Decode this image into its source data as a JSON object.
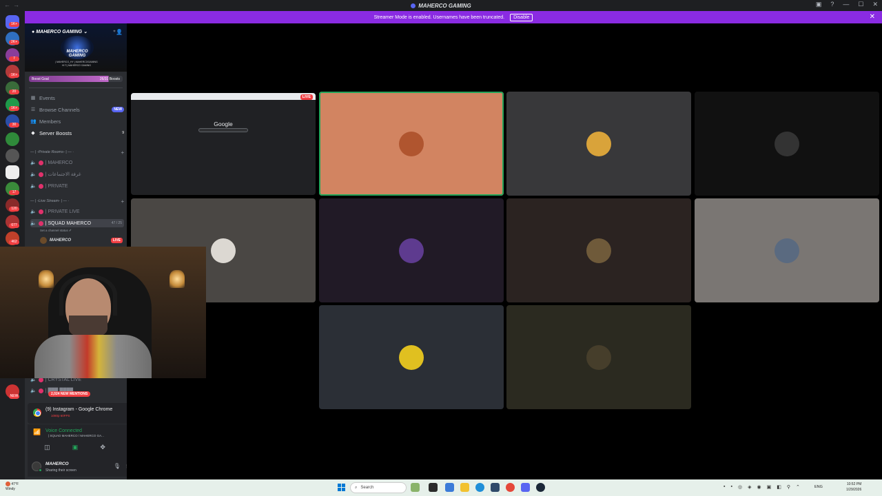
{
  "window": {
    "title": "MAHERCO GAMING"
  },
  "banner": {
    "text": "Streamer Mode is enabled. Usernames have been truncated.",
    "button": "Disable"
  },
  "rail_badges": [
    "1K+",
    "2K+",
    "7",
    "1K+",
    "20",
    "1K+",
    "30",
    "17",
    "120",
    "677",
    "462",
    "NEW"
  ],
  "server": {
    "name": "MAHERCO GAMING",
    "logo_text": "MAHERCO\nGAMING",
    "sub_text": "| MAHERCO_HY | MAHERCOGAMING\nHI T.| MAHERCO GAMING",
    "boost_label": "Boost Goal",
    "boost_value": "26/31 Boosts"
  },
  "nav": {
    "events": "Events",
    "browse": "Browse Channels",
    "browse_badge": "NEW",
    "members": "Members",
    "boosts": "Server Boosts",
    "boosts_count": "9"
  },
  "categories": {
    "private": "— | -Private Rooms- | — ·",
    "live": "— | -Live Stream- | — ·"
  },
  "channels": {
    "ch1": "| MAHERCO",
    "ch2": "| غرفة الاجتماعات",
    "ch3": "| PRIVATE",
    "ch4": "| PRIVATE LIVE",
    "ch5": "| SQUAD MAHERCO",
    "ch5_cap": "47 / 25",
    "ch5_status": "Set a channel status ✐",
    "ch6": "| CRYSTAL LIVE",
    "ch7": "| ███ ████"
  },
  "member_live": {
    "name": "MAHERCO",
    "badge": "LIVE"
  },
  "mentions": "2,024 NEW MENTIONS",
  "screen_share": {
    "title": "(9) Instagram - Google Chrome",
    "quality": "1080p 60FPS"
  },
  "voice": {
    "title": "Voice Connected",
    "channel": "| SQUAD MAHERCO / MAHERCO GA..."
  },
  "user": {
    "name": "MAHERCO",
    "status": "Sharing their screen"
  },
  "preview": {
    "google": "Google",
    "live": "LIVE"
  },
  "tiles": [
    {
      "bg": "#d28461",
      "avatar": "#b0552f",
      "speaking": true
    },
    {
      "bg": "#38383a",
      "avatar": "#d9a33a"
    },
    {
      "bg": "#111111",
      "avatar": "#333333"
    },
    {
      "bg": "#4a4744",
      "avatar": "#dcd8d2"
    },
    {
      "bg": "#211a26",
      "avatar": "#5e3b8f"
    },
    {
      "bg": "#2b2321",
      "avatar": "#6f5a3a"
    },
    {
      "bg": "#7a7673",
      "avatar": "#5a6a80"
    },
    {
      "bg": "#2b2f36",
      "avatar": "#e0c020"
    },
    {
      "bg": "#2b2a20",
      "avatar": "#463e2b"
    }
  ],
  "taskbar": {
    "temp": "47°F",
    "weather": "Windy",
    "search": "Search",
    "lang": "ENG",
    "time": "10:52 PM",
    "date": "1/29/2026"
  }
}
